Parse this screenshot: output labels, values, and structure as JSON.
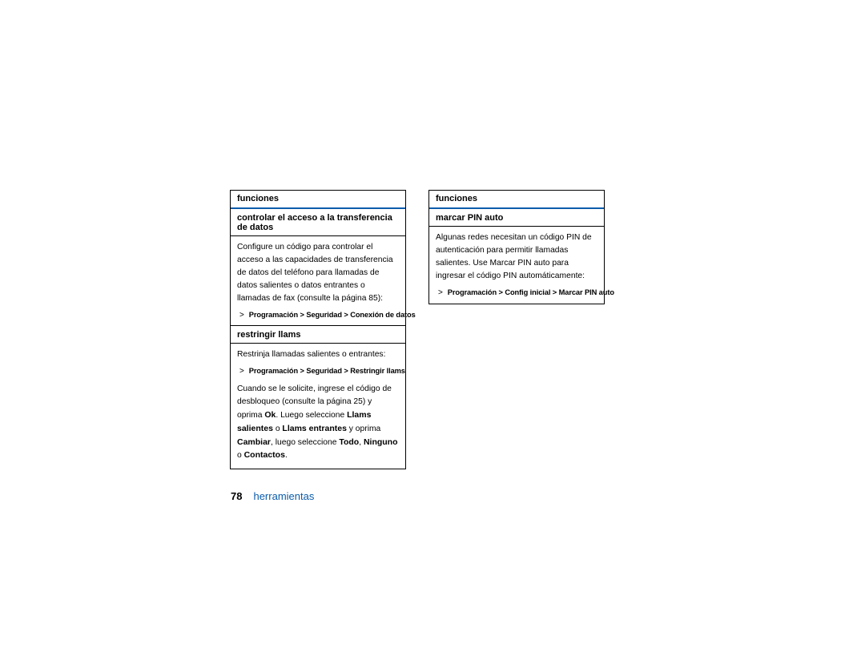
{
  "left": {
    "header": "funciones",
    "s1_title": "controlar el acceso a la transferencia de datos",
    "s1_body": "Configure un código para controlar el acceso a las capacidades de transferencia de datos del teléfono para llamadas de datos salientes o datos entrantes o llamadas de fax (consulte la página 85):",
    "s1_path": "Programación > Seguridad > Conexión de datos",
    "s2_title": "restringir llams",
    "s2_body1": "Restrinja llamadas salientes o entrantes:",
    "s2_path": "Programación > Seguridad > Restringir llams",
    "s2_body2_a": "Cuando se le solicite, ingrese el código de desbloqueo (consulte la página 25) y oprima ",
    "s2_body2_ok": "Ok",
    "s2_body2_b": ". Luego seleccione ",
    "s2_body2_ls": "Llams salientes",
    "s2_body2_o1": " o ",
    "s2_body2_le": "Llams entrantes",
    "s2_body2_c": " y oprima ",
    "s2_body2_cambiar": "Cambiar",
    "s2_body2_d": ", luego seleccione ",
    "s2_body2_todo": "Todo",
    "s2_body2_coma1": ", ",
    "s2_body2_ninguno": "Ninguno",
    "s2_body2_o2": " o ",
    "s2_body2_contactos": "Contactos",
    "s2_body2_dot": "."
  },
  "right": {
    "header": "funciones",
    "s1_title": "marcar PIN auto",
    "s1_body": "Algunas redes necesitan un código PIN de autenticación para permitir llamadas salientes. Use Marcar PIN auto para ingresar el código PIN automáticamente:",
    "s1_path": "Programación > Config inicial > Marcar PIN auto"
  },
  "footer": {
    "page": "78",
    "section": "herramientas"
  }
}
